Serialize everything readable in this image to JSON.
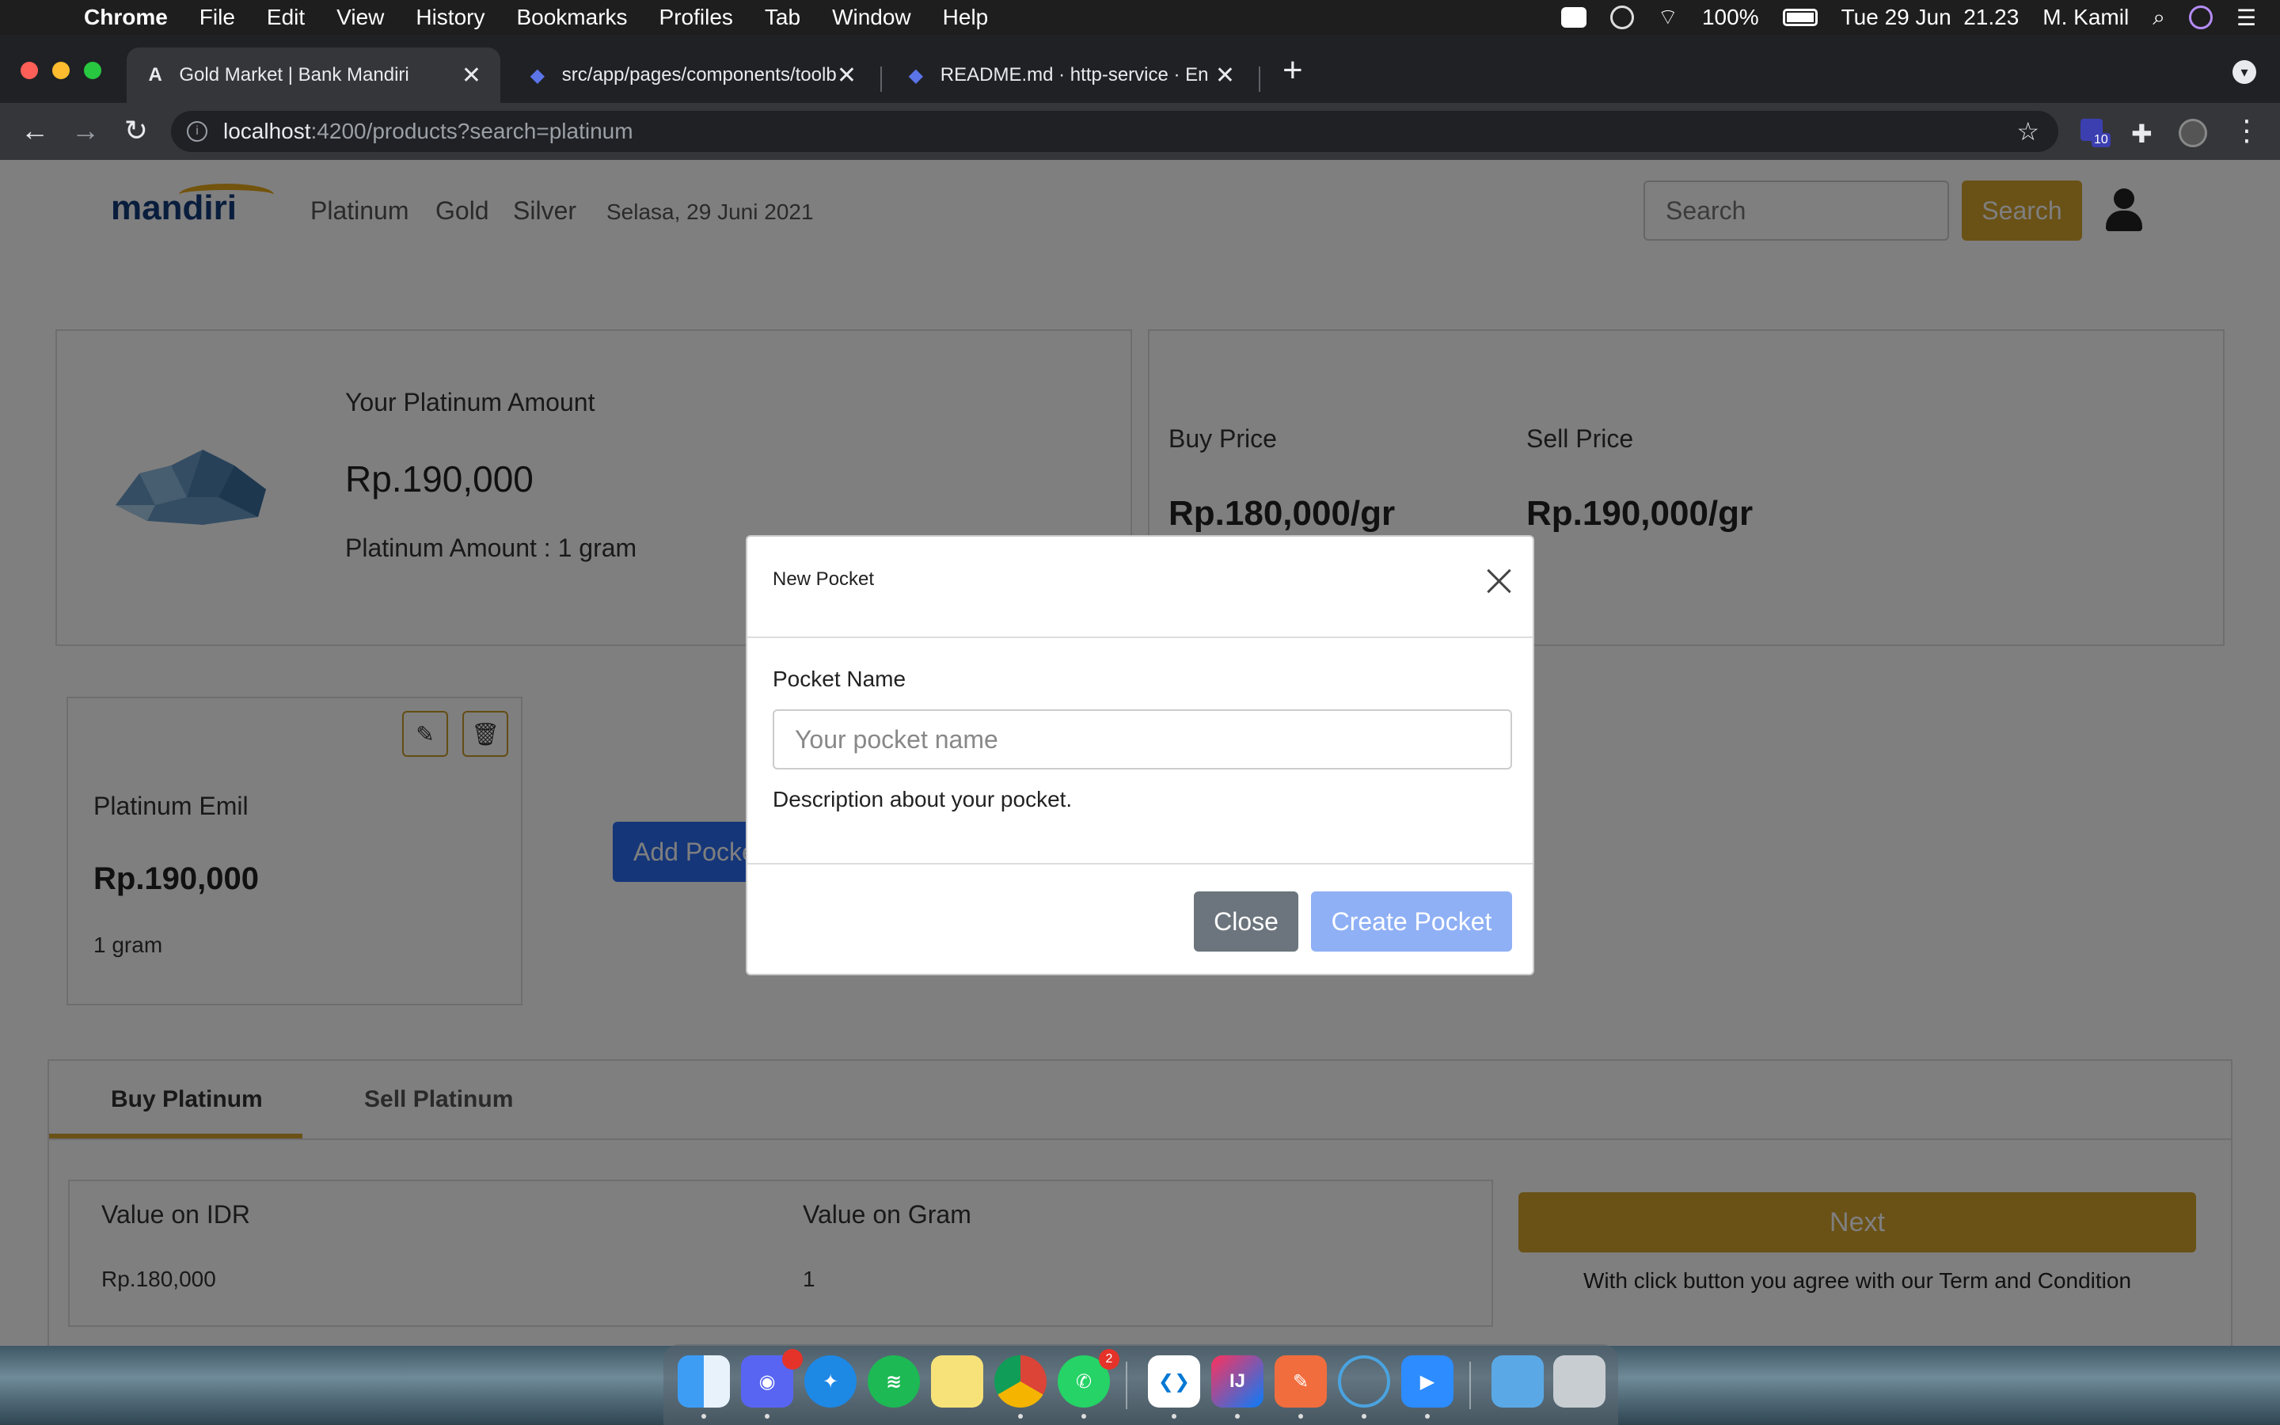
{
  "menubar": {
    "app": "Chrome",
    "items": [
      "File",
      "Edit",
      "View",
      "History",
      "Bookmarks",
      "Profiles",
      "Tab",
      "Window",
      "Help"
    ],
    "battery": "100%",
    "clock": "Tue 29 Jun  21.23",
    "user": "M. Kamil"
  },
  "browser": {
    "tabs": [
      {
        "title": "Gold Market | Bank Mandiri",
        "favicon": "angular-icon",
        "active": true
      },
      {
        "title": "src/app/pages/components/toolbar",
        "favicon": "dev-icon",
        "active": false
      },
      {
        "title": "README.md · http-service · En",
        "favicon": "dev-icon",
        "active": false
      }
    ],
    "url_host": "localhost",
    "url_path": ":4200/products?search=platinum",
    "extension_badge": "10"
  },
  "site": {
    "brand": "mandiri",
    "nav": [
      "Platinum",
      "Gold",
      "Silver"
    ],
    "date": "Selasa, 29 Juni 2021",
    "search_placeholder": "Search",
    "search_button": "Search"
  },
  "amount_card": {
    "heading": "Your Platinum Amount",
    "value": "Rp.190,000",
    "amount": "Platinum Amount : 1 gram"
  },
  "price_card": {
    "buy_label": "Buy Price",
    "buy_value": "Rp.180,000/gr",
    "sell_label": "Sell Price",
    "sell_value": "Rp.190,000/gr"
  },
  "pocket": {
    "name": "Platinum Emil",
    "value": "Rp.190,000",
    "weight": "1 gram"
  },
  "add_pocket_label": "Add Pocket",
  "trade": {
    "tabs": [
      "Buy Platinum",
      "Sell Platinum"
    ],
    "idr_label": "Value on IDR",
    "idr_value": "Rp.180,000",
    "gram_label": "Value on Gram",
    "gram_value": "1",
    "next_label": "Next",
    "terms": "With click button you agree with our Term and Condition"
  },
  "modal": {
    "title": "New Pocket",
    "field_label": "Pocket Name",
    "placeholder": "Your pocket name",
    "help": "Description about your pocket.",
    "close_label": "Close",
    "create_label": "Create Pocket"
  },
  "dock": {
    "apps": [
      "finder",
      "discord",
      "safari",
      "spotify",
      "notes",
      "chrome",
      "whatsapp",
      "vscode",
      "intellij",
      "pencil",
      "eclipse",
      "zoom",
      "folder",
      "trash"
    ],
    "badges": {
      "discord": "",
      "whatsapp": "2"
    }
  },
  "colors": {
    "brand_gold": "#d4a32c",
    "primary_blue": "#2b6cf0",
    "brand_navy": "#123b7a"
  }
}
